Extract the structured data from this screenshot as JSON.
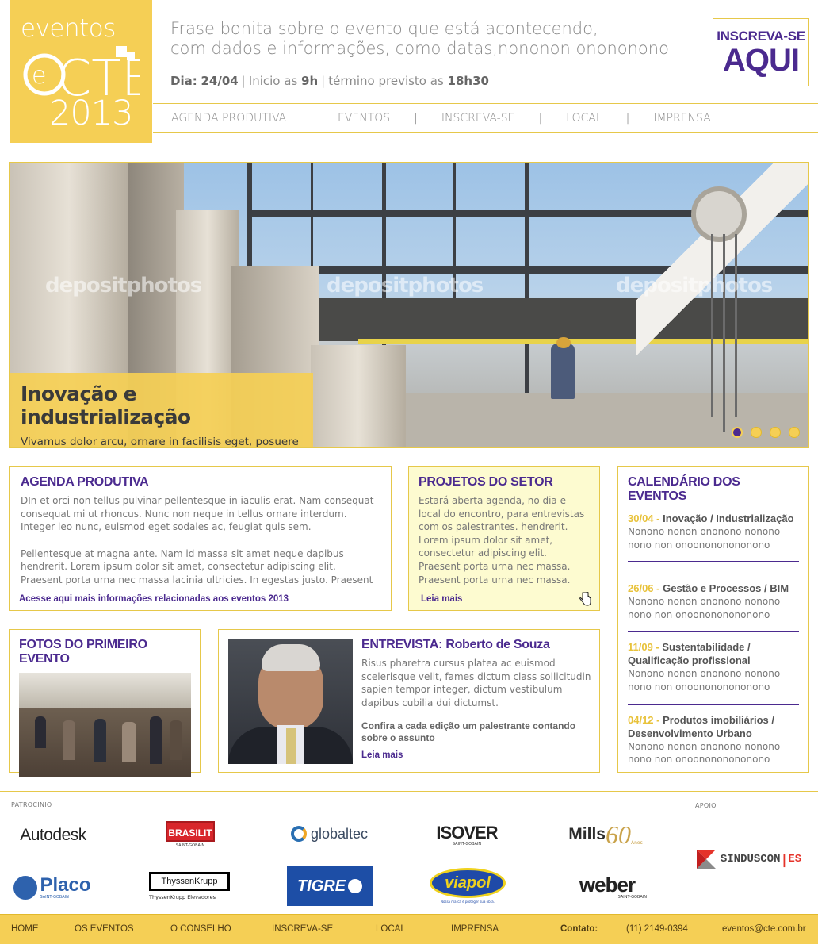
{
  "logo": {
    "line1": "eventos",
    "brand": "CTE",
    "year": "2013"
  },
  "header": {
    "tagline_1": "Frase bonita sobre o evento que está acontecendo,",
    "tagline_2": "com dados e informações, como datas,nononon onononono",
    "date_label": "Dia:",
    "date_value": "24/04",
    "start_label": "Inicio as",
    "start_value": "9h",
    "end_label": "término previsto as",
    "end_value": "18h30",
    "cta_line1": "INSCREVA-SE",
    "cta_line2": "AQUI"
  },
  "nav": {
    "items": [
      "AGENDA PRODUTIVA",
      "EVENTOS",
      "INSCREVA-SE",
      "LOCAL",
      "IMPRENSA"
    ],
    "separator": "|"
  },
  "hero": {
    "title": "Inovação e industrialização",
    "text": "Vivamus dolor arcu, ornare in facilisis eget, posuere nec elit. Ut scelerisque malesuada massa ac facilisis.",
    "watermark": "depositphotos",
    "active_slide": 1,
    "slide_count": 4
  },
  "agenda": {
    "title": "AGENDA PRODUTIVA",
    "p1": "DIn et orci non tellus pulvinar pellentesque in iaculis erat. Nam consequat consequat mi ut rhoncus. Nunc non neque in tellus ornare interdum. Integer leo nunc, euismod eget sodales ac, feugiat quis sem.",
    "p2": "Pellentesque at magna ante. Nam id massa sit amet neque dapibus hendrerit. Lorem ipsum dolor sit amet, consectetur adipiscing elit. Praesent porta urna nec massa lacinia ultricies. In egestas justo. Praesent",
    "link": "Acesse aqui mais informações relacionadas aos eventos 2013"
  },
  "projetos": {
    "title": "PROJETOS DO SETOR",
    "text": "Estará aberta agenda, no dia e local do encontro, para entrevistas com os palestrantes. hendrerit. Lorem ipsum dolor sit amet, consectetur adipiscing elit. Praesent porta urna nec massa. Praesent porta urna nec massa.",
    "link": "Leia mais"
  },
  "calendario": {
    "title": "CALENDÁRIO DOS EVENTOS",
    "events": [
      {
        "date": "30/04",
        "sep": " - ",
        "name": "Inovação / Industrialização",
        "desc": "Nonono nonon ononono nonono nono non onoonononononono"
      },
      {
        "date": "26/06",
        "sep": " - ",
        "name": "Gestão e Processos / BIM",
        "desc": "Nonono nonon ononono nonono nono non onoonononononono"
      },
      {
        "date": "11/09",
        "sep": " - ",
        "name": "Sustentabilidade / Qualificação profissional",
        "desc": "Nonono nonon ononono nonono nono non onoonononononono"
      },
      {
        "date": "04/12",
        "sep": " - ",
        "name": "Produtos imobiliários / Desenvolvimento Urbano",
        "desc": "Nonono nonon ononono nonono nono non onoonononononono"
      }
    ]
  },
  "fotos": {
    "title": "FOTOS DO PRIMEIRO EVENTO"
  },
  "entrevista": {
    "title": "ENTREVISTA: Roberto de Souza",
    "text": "Risus pharetra cursus platea ac euismod scelerisque velit, fames dictum class sollicitudin sapien tempor integer, dictum vestibulum dapibus cubilia dui dictumst.",
    "confira": "Confira a cada edição um palestrante contando sobre o assunto",
    "link": "Leia mais"
  },
  "sponsors": {
    "label_patrocinio": "PATROCINIO",
    "label_apoio": "APOIO",
    "autodesk": "Autodesk",
    "brasilit": "BRASILIT",
    "brasilit_sub": "SAINT-GOBAIN",
    "globaltec": "globaltec",
    "isover": "ISOVER",
    "isover_sub": "SAINT-GOBAIN",
    "mills": "Mills",
    "mills_num": "60",
    "mills_sub": "Anos",
    "placo": "Placo",
    "placo_sub": "SAINT-GOBAIN",
    "thyssen": "ThyssenKrupp",
    "thyssen_sub": "ThyssenKrupp Elevadores",
    "tigre": "TIGRE",
    "viapol": "viapol",
    "viapol_sub": "Nossa marca é proteger sua obra.",
    "weber": "weber",
    "weber_sub": "SAINT-GOBAIN",
    "sinduscon": "SINDUSCON",
    "sinduscon_es": "ES"
  },
  "footer": {
    "links": [
      "HOME",
      "OS EVENTOS",
      "O CONSELHO",
      "INSCREVA-SE",
      "LOCAL",
      "IMPRENSA"
    ],
    "separator": "|",
    "contact_label": "Contato:",
    "phone": "(11) 2149-0394",
    "email": "eventos@cte.com.br"
  },
  "colors": {
    "accent_yellow": "#f5cf55",
    "accent_purple": "#4b2a8f",
    "border": "#e6c84a"
  }
}
